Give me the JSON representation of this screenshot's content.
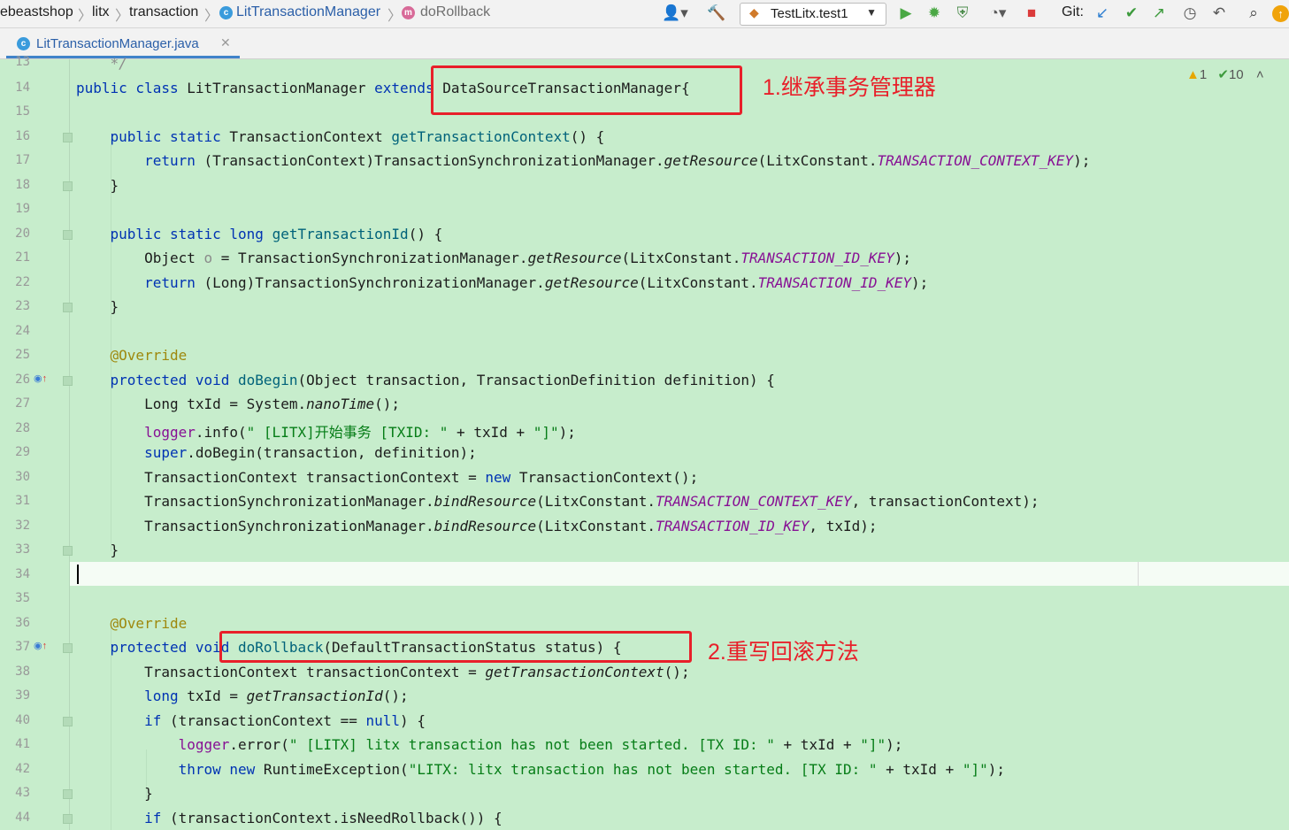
{
  "breadcrumbs": {
    "project": "ebeastshop",
    "module": "litx",
    "package": "transaction",
    "class": "LitTransactionManager",
    "method": "doRollback"
  },
  "toolbar": {
    "run_config": "TestLitx.test1",
    "git_label": "Git:"
  },
  "tab": {
    "file_name": "LitTransactionManager.java"
  },
  "inspections": {
    "warnings": "1",
    "typos": "10"
  },
  "annotations": {
    "note1": "1.继承事务管理器",
    "note2": "2.重写回滚方法"
  },
  "line_numbers": [
    "13",
    "14",
    "15",
    "16",
    "17",
    "18",
    "19",
    "20",
    "21",
    "22",
    "23",
    "24",
    "25",
    "26",
    "27",
    "28",
    "29",
    "30",
    "31",
    "32",
    "33",
    "34",
    "35",
    "36",
    "37",
    "38",
    "39",
    "40",
    "41",
    "42",
    "43",
    "44"
  ],
  "code": {
    "l13": {
      "t1": "    */"
    },
    "l14": {
      "t1": "public class",
      "t2": " LitTransactionManager ",
      "t3": "extends",
      "t4": " DataSourceTransactionManager{"
    },
    "l16": {
      "t1": "    public static",
      "t2": " TransactionContext ",
      "t3": "getTransactionContext",
      "t4": "() {"
    },
    "l17": {
      "t1": "        return",
      "t2": " (TransactionContext)TransactionSynchronizationManager.",
      "t3": "getResource",
      "t4": "(LitxConstant.",
      "t5": "TRANSACTION_CONTEXT_KEY",
      "t6": ");"
    },
    "l18": {
      "t1": "    }"
    },
    "l20": {
      "t1": "    public static long",
      "t2": " ",
      "t3": "getTransactionId",
      "t4": "() {"
    },
    "l21": {
      "t1": "        Object ",
      "t2": "o",
      "t3": " = TransactionSynchronizationManager.",
      "t4": "getResource",
      "t5": "(LitxConstant.",
      "t6": "TRANSACTION_ID_KEY",
      "t7": ");"
    },
    "l22": {
      "t1": "        return",
      "t2": " (Long)TransactionSynchronizationManager.",
      "t3": "getResource",
      "t4": "(LitxConstant.",
      "t5": "TRANSACTION_ID_KEY",
      "t6": ");"
    },
    "l23": {
      "t1": "    }"
    },
    "l25": {
      "t1": "    @Override"
    },
    "l26": {
      "t1": "    protected void",
      "t2": " ",
      "t3": "doBegin",
      "t4": "(Object transaction, TransactionDefinition definition) {"
    },
    "l27": {
      "t1": "        Long txId = System.",
      "t2": "nanoTime",
      "t3": "();"
    },
    "l28": {
      "t1": "        ",
      "t2": "logger",
      "t3": ".info(",
      "t4": "\" [LITX]开始事务 [TXID: \"",
      "t5": " + txId + ",
      "t6": "\"]\"",
      "t7": ");"
    },
    "l29": {
      "t1": "        super",
      "t2": ".doBegin(transaction, definition);"
    },
    "l30": {
      "t1": "        TransactionContext transactionContext = ",
      "t2": "new",
      "t3": " TransactionContext();"
    },
    "l31": {
      "t1": "        TransactionSynchronizationManager.",
      "t2": "bindResource",
      "t3": "(LitxConstant.",
      "t4": "TRANSACTION_CONTEXT_KEY",
      "t5": ", transactionContext);"
    },
    "l32": {
      "t1": "        TransactionSynchronizationManager.",
      "t2": "bindResource",
      "t3": "(LitxConstant.",
      "t4": "TRANSACTION_ID_KEY",
      "t5": ", txId);"
    },
    "l33": {
      "t1": "    }"
    },
    "l36": {
      "t1": "    @Override"
    },
    "l37": {
      "t1": "    protected void",
      "t2": " ",
      "t3": "doRollback",
      "t4": "(DefaultTransactionStatus status) {"
    },
    "l38": {
      "t1": "        TransactionContext transactionContext = ",
      "t2": "getTransactionContext",
      "t3": "();"
    },
    "l39": {
      "t1": "        long",
      "t2": " txId = ",
      "t3": "getTransactionId",
      "t4": "();"
    },
    "l40": {
      "t1": "        if",
      "t2": " (transactionContext == ",
      "t3": "null",
      "t4": ") {"
    },
    "l41": {
      "t1": "            ",
      "t2": "logger",
      "t3": ".error(",
      "t4": "\" [LITX] litx transaction has not been started. [TX ID: \"",
      "t5": " + txId + ",
      "t6": "\"]\"",
      "t7": ");"
    },
    "l42": {
      "t1": "            throw new",
      "t2": " RuntimeException(",
      "t3": "\"LITX: litx transaction has not been started. [TX ID: \"",
      "t4": " + txId + ",
      "t5": "\"]\"",
      "t6": ");"
    },
    "l43": {
      "t1": "        }"
    },
    "l44": {
      "t1": "        if",
      "t2": " (transactionContext.isNeedRollback()) {"
    }
  }
}
